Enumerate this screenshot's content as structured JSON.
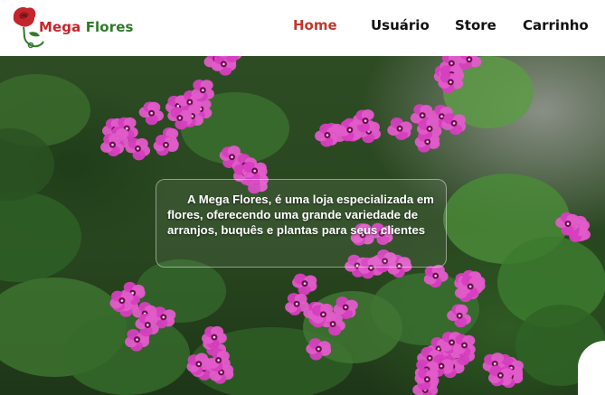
{
  "header": {
    "brand_part1": "Mega",
    "brand_part2": "Flores",
    "logo_icon": "rose-icon"
  },
  "nav": {
    "items": [
      {
        "label": "Home",
        "active": true
      },
      {
        "label": "Usuário",
        "active": false
      },
      {
        "label": "Store",
        "active": false
      },
      {
        "label": "Carrinho",
        "active": false
      }
    ]
  },
  "hero": {
    "caption": "A Mega Flores, é uma loja especializada em flores, oferecendo uma grande variedade de arranjos, buquês e plantas para seus clientes"
  },
  "colors": {
    "brand_red": "#c3262c",
    "brand_green": "#2f7a2a",
    "nav_active": "#c0392b",
    "flower_pink": "#d63fbf"
  }
}
